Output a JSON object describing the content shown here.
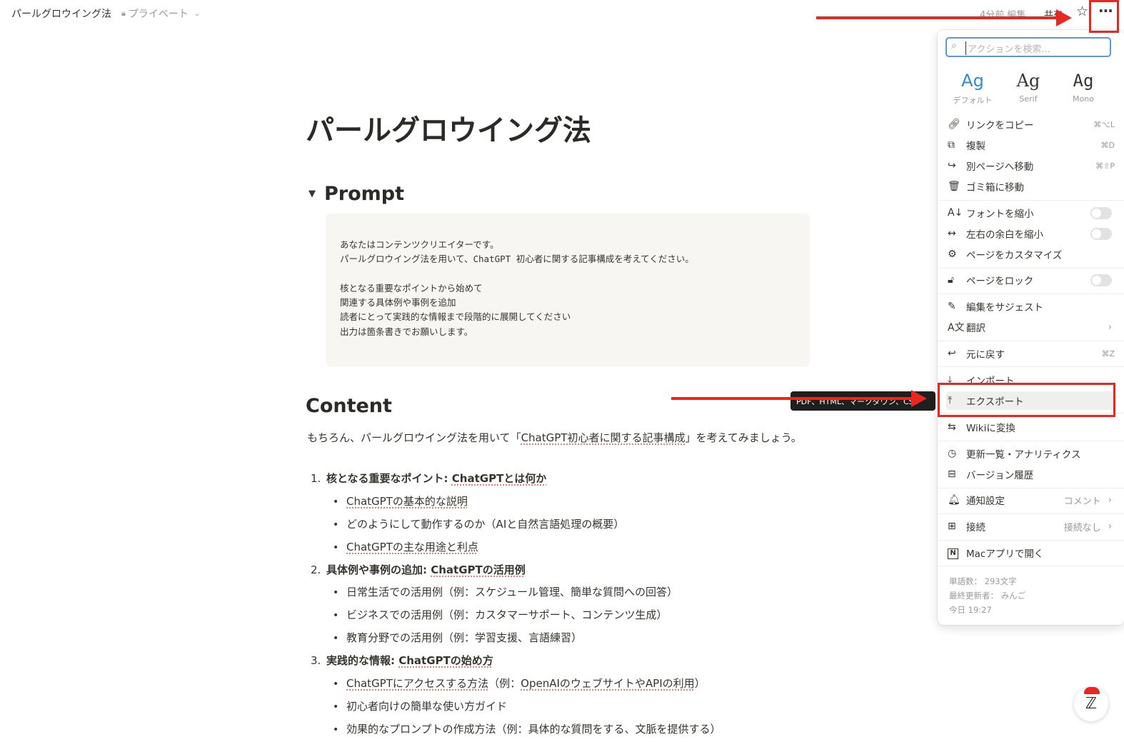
{
  "topbar": {
    "title": "パールグロウイング法",
    "privacy_label": "プライベート",
    "edited": "4分前 編集",
    "share": "共有"
  },
  "icons": {
    "lock": "lock-icon",
    "star": "star-icon",
    "more": "more-icon"
  },
  "page": {
    "title": "パールグロウイング法",
    "toggle_heading": "Prompt",
    "code_lines": [
      "あなたはコンテンツクリエイターです。",
      "パールグロウイング法を用いて、ChatGPT 初心者に関する記事構成を考えてください。",
      "",
      "核となる重要なポイントから始めて",
      "関連する具体例や事例を追加",
      "読者にとって実践的な情報まで段階的に展開してください",
      "出力は箇条書きでお願いします。"
    ],
    "content_heading": "Content",
    "intro_before": "もちろん、パールグロウイング法を用いて「",
    "intro_link": "ChatGPT初心者に関する記事構成",
    "intro_after": "」を考えてみましょう。",
    "items": [
      {
        "num": "1.",
        "label": "核となる重要なポイント: ",
        "link": "ChatGPTとは何か",
        "bullets": [
          {
            "text": "",
            "link": "ChatGPTの基本的な説明",
            "after": ""
          },
          {
            "text": "どのようにして動作するのか（AIと自然言語処理の概要）",
            "link": "",
            "after": ""
          },
          {
            "text": "",
            "link": "ChatGPTの主な用途と利点",
            "after": ""
          }
        ]
      },
      {
        "num": "2.",
        "label": "具体例や事例の追加: ",
        "link": "ChatGPTの活用例",
        "bullets": [
          {
            "text": "日常生活での活用例（例：スケジュール管理、簡単な質問への回答）",
            "link": "",
            "after": ""
          },
          {
            "text": "ビジネスでの活用例（例：カスタマーサポート、コンテンツ生成）",
            "link": "",
            "after": ""
          },
          {
            "text": "教育分野での活用例（例：学習支援、言語練習）",
            "link": "",
            "after": ""
          }
        ]
      },
      {
        "num": "3.",
        "label": "実践的な情報: ",
        "link": "ChatGPTの始め方",
        "bullets": [
          {
            "text": "",
            "link": "ChatGPTにアクセスする方法",
            "after": "（例：",
            "link2": "OpenAIのウェブサイトやAPIの利用",
            "after2": "）"
          },
          {
            "text": "初心者向けの簡単な使い方ガイド",
            "link": "",
            "after": ""
          },
          {
            "text": "効果的なプロンプトの作成方法（例：具体的な質問をする、文脈を提供する）",
            "link": "",
            "after": ""
          }
        ]
      }
    ]
  },
  "menu": {
    "search_placeholder": "アクションを検索...",
    "fonts": [
      {
        "sample": "Ag",
        "label": "デフォルト"
      },
      {
        "sample": "Ag",
        "label": "Serif"
      },
      {
        "sample": "Ag",
        "label": "Mono"
      }
    ],
    "items": {
      "copy_link": {
        "label": "リンクをコピー",
        "shortcut": "⌘⌥L",
        "icon": "link-icon"
      },
      "duplicate": {
        "label": "複製",
        "shortcut": "⌘D",
        "icon": "duplicate-icon"
      },
      "move_to": {
        "label": "別ページへ移動",
        "shortcut": "⌘⇧P",
        "icon": "move-arrow-icon"
      },
      "trash": {
        "label": "ゴミ箱に移動",
        "icon": "trash-icon"
      },
      "small_text": {
        "label": "フォントを縮小",
        "icon": "font-size-icon"
      },
      "full_width": {
        "label": "左右の余白を縮小",
        "icon": "width-arrows-icon"
      },
      "customize": {
        "label": "ページをカスタマイズ",
        "icon": "sliders-icon"
      },
      "lock_page": {
        "label": "ページをロック",
        "icon": "unlock-icon"
      },
      "suggest": {
        "label": "編集をサジェスト",
        "icon": "suggest-edit-icon"
      },
      "translate": {
        "label": "翻訳",
        "icon": "translate-icon"
      },
      "undo": {
        "label": "元に戻す",
        "shortcut": "⌘Z",
        "icon": "undo-icon"
      },
      "import": {
        "label": "インポート",
        "icon": "import-icon"
      },
      "export": {
        "label": "エクスポート",
        "icon": "export-icon"
      },
      "wiki": {
        "label": "Wikiに変換",
        "icon": "wiki-convert-icon"
      },
      "updates": {
        "label": "更新一覧・アナリティクス",
        "icon": "clock-icon"
      },
      "history": {
        "label": "バージョン履歴",
        "icon": "history-stack-icon"
      },
      "notify": {
        "label": "通知設定",
        "value": "コメント",
        "icon": "bell-icon"
      },
      "connections": {
        "label": "接続",
        "value": "接続なし",
        "icon": "grid-icon"
      },
      "mac_app": {
        "label": "Macアプリで開く",
        "icon": "notion-logo-icon"
      }
    },
    "footer": {
      "word_count": "単語数： 293文字",
      "last_editor": "最終更新者： みんご",
      "last_time": "今日 19:27"
    }
  },
  "tooltip": "PDF、HTML、マークダウン、CSV",
  "colors": {
    "annotation_red": "#e8281e",
    "accent_blue": "#2e8bd6",
    "text": "#37352f",
    "muted": "#9b9a97",
    "code_bg": "#f7f6f3"
  }
}
